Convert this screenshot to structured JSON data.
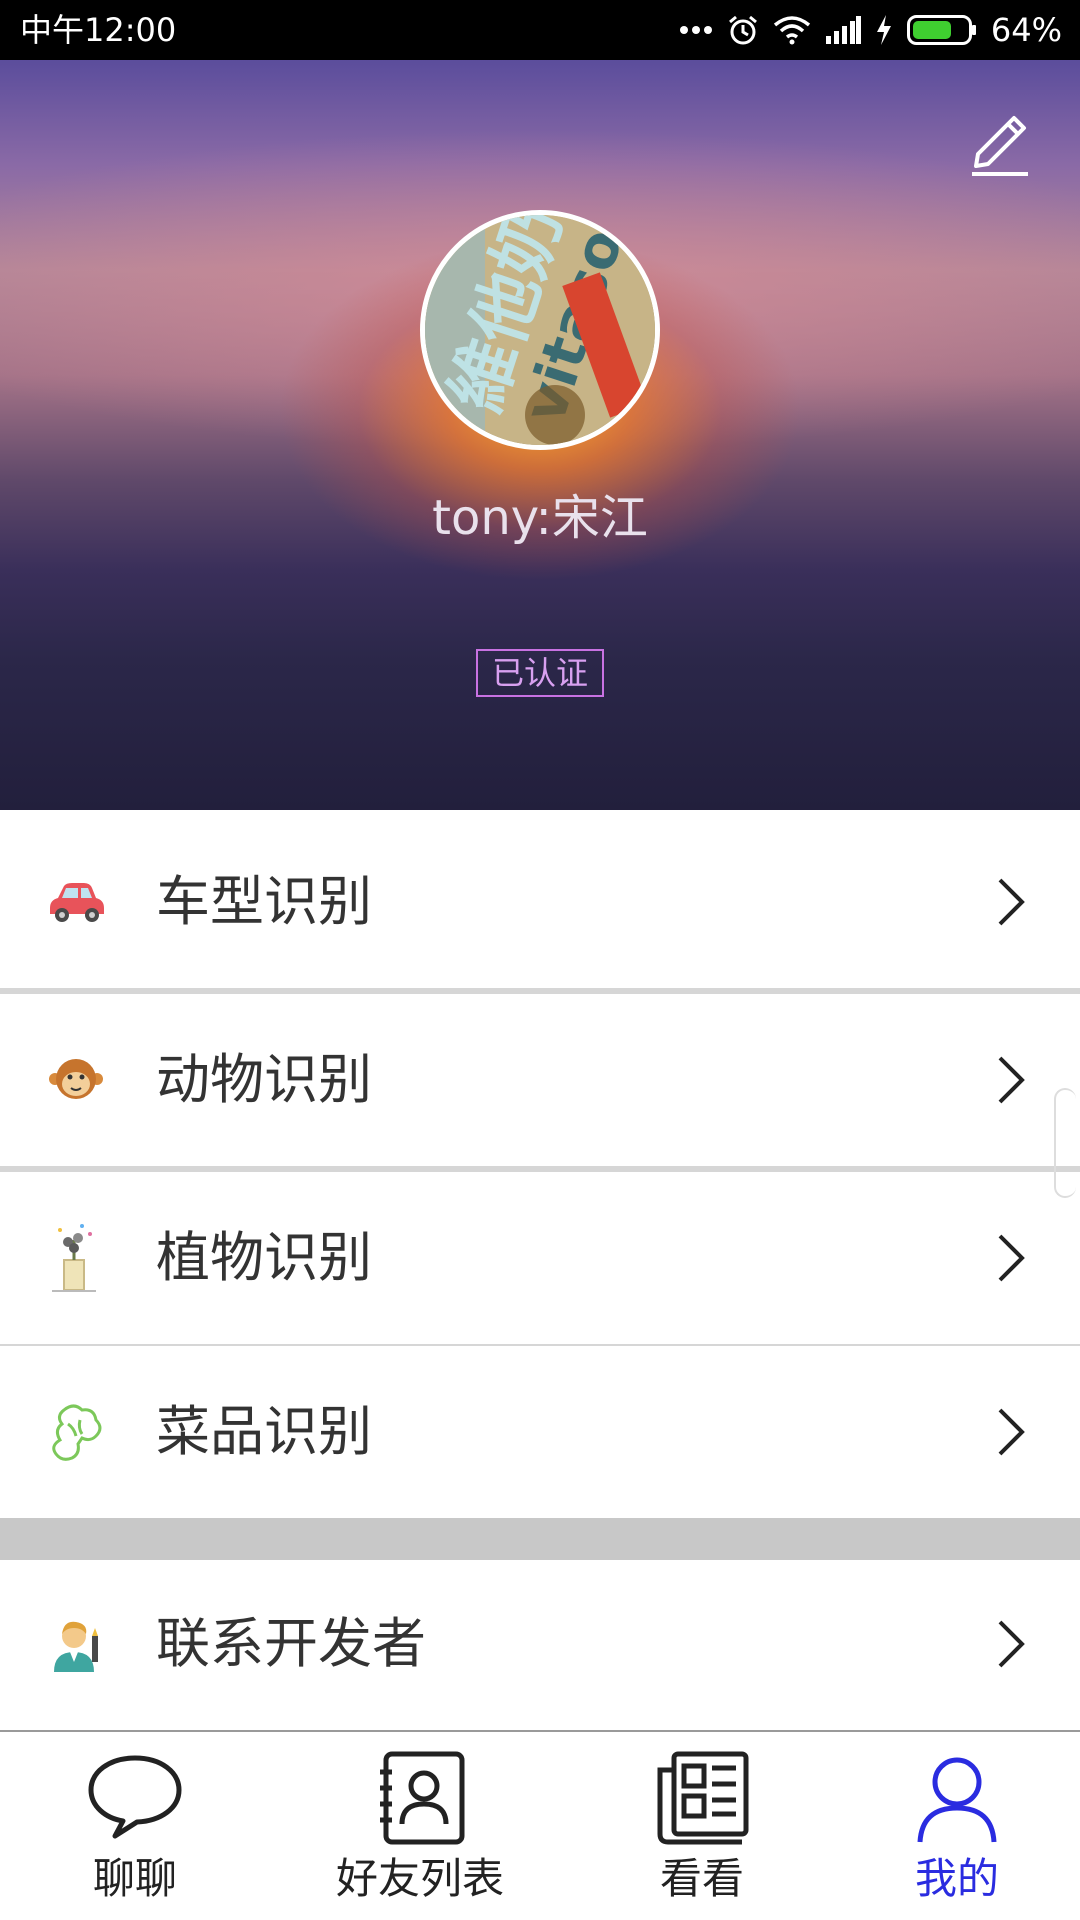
{
  "status_bar": {
    "time": "中午12:00",
    "battery": "64%",
    "icons": [
      "more-dots-icon",
      "alarm-icon",
      "wifi-icon",
      "signal-icon",
      "charging-icon",
      "battery-icon"
    ]
  },
  "profile": {
    "username": "tony:宋江",
    "verified_label": "已认证",
    "avatar_text": "維他奶 vitasoy",
    "edit_icon": "pencil-icon"
  },
  "menu": {
    "items": [
      {
        "label": "车型识别",
        "icon": "car-icon"
      },
      {
        "label": "动物识别",
        "icon": "monkey-icon"
      },
      {
        "label": "植物识别",
        "icon": "plant-icon"
      },
      {
        "label": "菜品识别",
        "icon": "broccoli-icon"
      }
    ],
    "contact": {
      "label": "联系开发者",
      "icon": "developer-icon"
    }
  },
  "bottom_nav": {
    "tabs": [
      {
        "label": "聊聊",
        "icon": "chat-bubble-icon"
      },
      {
        "label": "好友列表",
        "icon": "contacts-book-icon"
      },
      {
        "label": "看看",
        "icon": "news-icon"
      },
      {
        "label": "我的",
        "icon": "user-icon"
      }
    ],
    "active_index": 3
  },
  "colors": {
    "active_tab": "#2a2ce0",
    "verified_border": "#c872e2",
    "divider": "#d6d6d6"
  }
}
